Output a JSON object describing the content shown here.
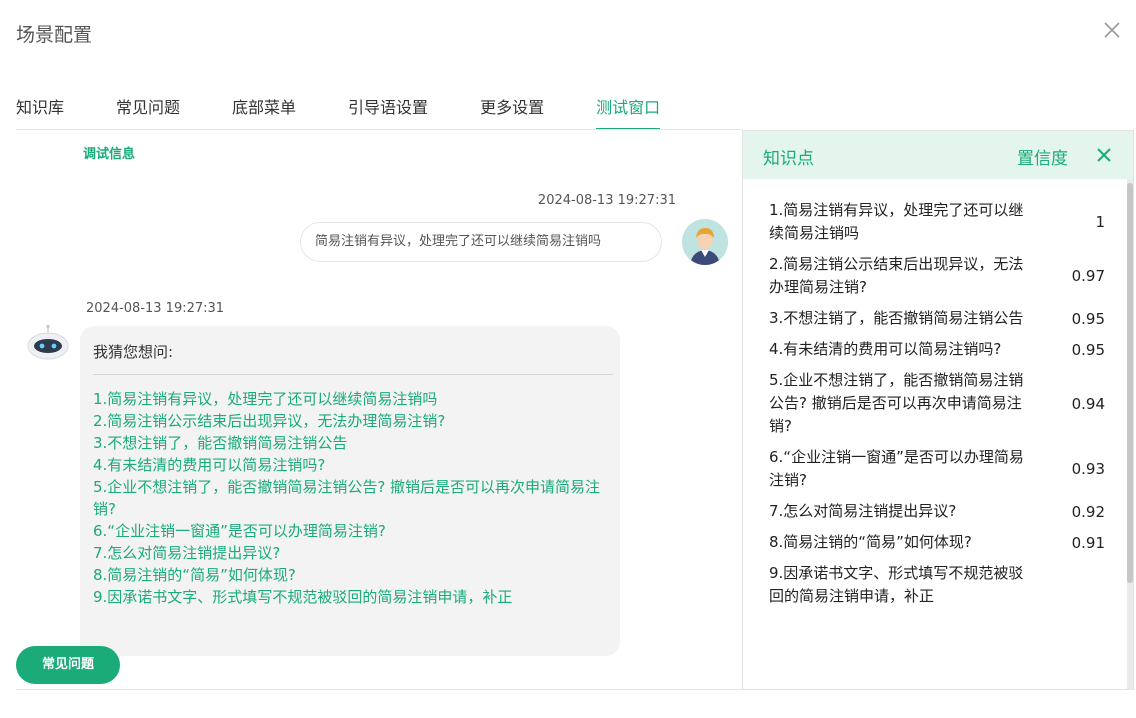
{
  "dialog": {
    "title": "场景配置"
  },
  "tabs": [
    {
      "label": "知识库"
    },
    {
      "label": "常见问题"
    },
    {
      "label": "底部菜单"
    },
    {
      "label": "引导语设置"
    },
    {
      "label": "更多设置"
    },
    {
      "label": "测试窗口",
      "active": true
    }
  ],
  "chat": {
    "debug_label": "调试信息",
    "user_message": {
      "time": "2024-08-13 19:27:31",
      "text": "简易注销有异议，处理完了还可以继续简易注销吗"
    },
    "bot_message": {
      "time": "2024-08-13 19:27:31",
      "heading": "我猜您想问:",
      "suggestions": [
        "1.简易注销有异议，处理完了还可以继续简易注销吗",
        "2.简易注销公示结束后出现异议，无法办理简易注销?",
        "3.不想注销了，能否撤销简易注销公告",
        "4.有未结清的费用可以简易注销吗?",
        "5.企业不想注销了，能否撤销简易注销公告? 撤销后是否可以再次申请简易注销?",
        "6.“企业注销一窗通”是否可以办理简易注销?",
        "7.怎么对简易注销提出异议?",
        "8.简易注销的“简易”如何体现?",
        "9.因承诺书文字、形式填写不规范被驳回的简易注销申请，补正"
      ]
    },
    "faq_button": "常见问题"
  },
  "knowledge_panel": {
    "title": "知识点",
    "confidence_label": "置信度",
    "items": [
      {
        "text": "1.简易注销有异议，处理完了还可以继续简易注销吗",
        "score": "1"
      },
      {
        "text": "2.简易注销公示结束后出现异议，无法办理简易注销?",
        "score": "0.97"
      },
      {
        "text": "3.不想注销了，能否撤销简易注销公告",
        "score": "0.95"
      },
      {
        "text": "4.有未结清的费用可以简易注销吗?",
        "score": "0.95"
      },
      {
        "text": "5.企业不想注销了，能否撤销简易注销公告? 撤销后是否可以再次申请简易注销?",
        "score": "0.94"
      },
      {
        "text": "6.“企业注销一窗通”是否可以办理简易注销?",
        "score": "0.93"
      },
      {
        "text": "7.怎么对简易注销提出异议?",
        "score": "0.92"
      },
      {
        "text": "8.简易注销的“简易”如何体现?",
        "score": "0.91"
      },
      {
        "text": "9.因承诺书文字、形式填写不规范被驳回的简易注销申请，补正",
        "score": ""
      }
    ]
  },
  "colors": {
    "accent": "#1aab79",
    "panel_header_bg": "#e3f5ec",
    "bubble_bg": "#f3f3f3"
  },
  "icons": {
    "close": "close-icon",
    "user_avatar": "user-avatar",
    "bot_avatar": "robot-avatar"
  }
}
